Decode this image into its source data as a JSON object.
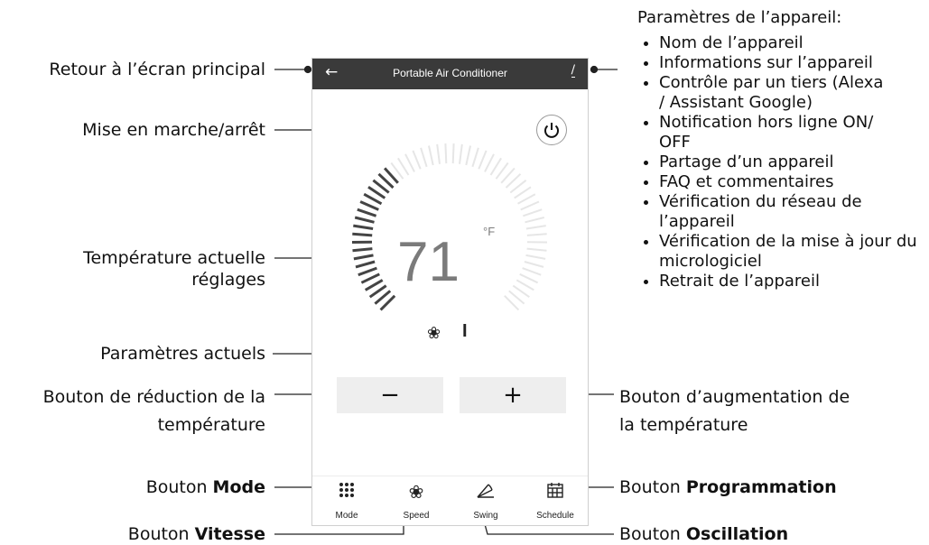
{
  "app": {
    "title": "Portable Air Conditioner",
    "back_icon": "arrow-left-icon",
    "edit_icon": "pencil-icon"
  },
  "thermostat": {
    "temperature": "71",
    "unit": "°F",
    "speed_level": "I",
    "decrease_label": "−",
    "increase_label": "+"
  },
  "tabs": [
    {
      "label": "Mode",
      "icon": "grid-icon"
    },
    {
      "label": "Speed",
      "icon": "fan-icon"
    },
    {
      "label": "Swing",
      "icon": "swing-icon"
    },
    {
      "label": "Schedule",
      "icon": "calendar-icon"
    }
  ],
  "annotations": {
    "back": "Retour à l’écran principal",
    "power": "Mise en marche/arrêt",
    "temp_line1": "Température actuelle",
    "temp_line2": "réglages",
    "current": "Paramètres actuels",
    "decrease_line1": "Bouton de réduction de la",
    "decrease_line2": "température",
    "mode_prefix": "Bouton ",
    "mode_bold": "Mode",
    "speed_prefix": "Bouton ",
    "speed_bold": "Vitesse",
    "increase_line1": "Bouton d’augmentation de",
    "increase_line2": "la température",
    "schedule_prefix": "Bouton ",
    "schedule_bold": "Programmation",
    "swing_prefix": "Bouton ",
    "swing_bold": "Oscillation"
  },
  "settings": {
    "heading": "Paramètres de l’appareil:",
    "items": [
      "Nom de l’appareil",
      "Informations sur l’appareil",
      "Contrôle par un tiers (Alexa / Assistant Google)",
      "Notification hors ligne ON/ OFF",
      "Partage d’un appareil",
      "FAQ et commentaires",
      "Vérification du réseau de l’appareil",
      "Vérification de la mise à jour du micrologiciel",
      "Retrait de l’appareil"
    ]
  },
  "colors": {
    "topbar": "#3a3a3a",
    "dial_active": "#444444",
    "dial_inactive": "#e6e6e6",
    "button_bg": "#eeeeee"
  }
}
